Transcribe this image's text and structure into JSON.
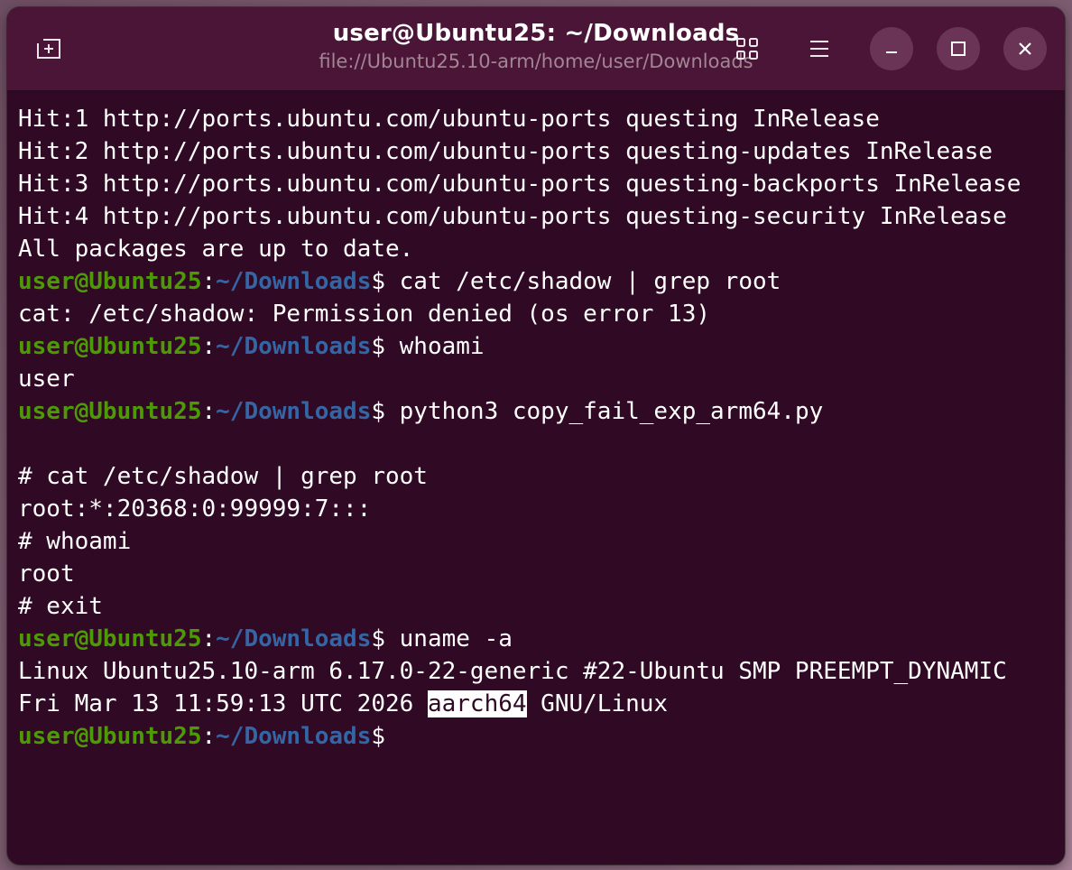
{
  "colors": {
    "terminal_bg": "#300a24",
    "titlebar_bg": "#4b1537",
    "prompt_user": "#4e9a06",
    "prompt_path": "#3465a4",
    "text": "#ffffff"
  },
  "window": {
    "title": "user@Ubuntu25: ~/Downloads",
    "subtitle": "file://Ubuntu25.10-arm/home/user/Downloads",
    "icons": {
      "new_tab": "new-tab-icon",
      "view": "grid-icon",
      "menu": "hamburger-menu-icon",
      "minimize": "minimize-icon",
      "maximize": "maximize-icon",
      "close": "close-icon"
    }
  },
  "prompt": {
    "user_host": "user@Ubuntu25",
    "separator": ":",
    "path": "~/Downloads",
    "symbol": "$"
  },
  "terminal": {
    "lines": [
      {
        "text": "Hit:1 http://ports.ubuntu.com/ubuntu-ports questing InRelease"
      },
      {
        "text": "Hit:2 http://ports.ubuntu.com/ubuntu-ports questing-updates InRelease"
      },
      {
        "text": "Hit:3 http://ports.ubuntu.com/ubuntu-ports questing-backports InRelease"
      },
      {
        "text": "Hit:4 http://ports.ubuntu.com/ubuntu-ports questing-security InRelease"
      },
      {
        "text": "All packages are up to date."
      },
      {
        "prompt": true,
        "command": " cat /etc/shadow | grep root"
      },
      {
        "text": "cat: /etc/shadow: Permission denied (os error 13)"
      },
      {
        "prompt": true,
        "command": " whoami"
      },
      {
        "text": "user"
      },
      {
        "prompt": true,
        "command": " python3 copy_fail_exp_arm64.py"
      },
      {
        "text": ""
      },
      {
        "text": "# cat /etc/shadow | grep root"
      },
      {
        "text": "root:*:20368:0:99999:7:::"
      },
      {
        "text": "# whoami"
      },
      {
        "text": "root"
      },
      {
        "text": "# exit"
      },
      {
        "prompt": true,
        "command": " uname -a"
      },
      {
        "text": "Linux Ubuntu25.10-arm 6.17.0-22-generic #22-Ubuntu SMP PREEMPT_DYNAMIC"
      },
      {
        "text_before": "Fri Mar 13 11:59:13 UTC 2026 ",
        "highlight": "aarch64",
        "text_after": " GNU/Linux"
      },
      {
        "prompt": true,
        "command": ""
      }
    ]
  }
}
